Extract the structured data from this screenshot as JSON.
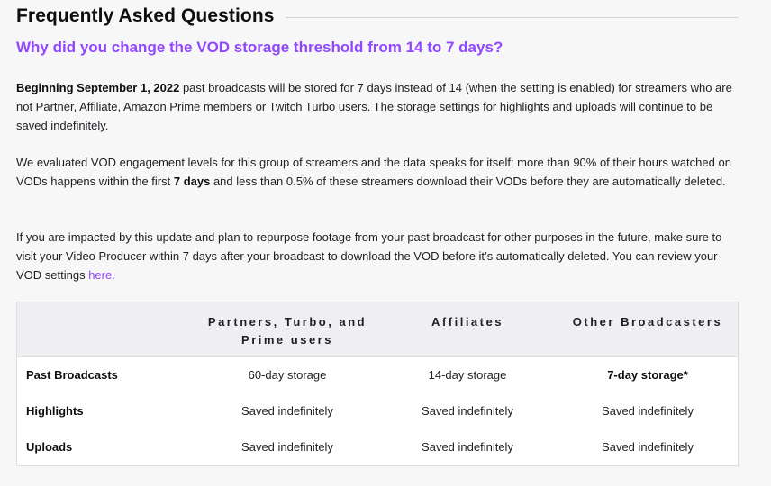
{
  "faq": {
    "title": "Frequently Asked Questions",
    "question": "Why did you change the VOD storage threshold from 14 to 7 days?",
    "p1": {
      "bold_lead": "Beginning September 1, 2022",
      "text": " past broadcasts will be stored for 7 days instead of 14 (when the setting is enabled) for streamers who are not Partner, Affiliate, Amazon Prime members or Twitch Turbo users. The storage settings for highlights and uploads will continue to be saved indefinitely."
    },
    "p2": {
      "text_before": "We evaluated VOD engagement levels for this group of streamers and the data speaks for itself: more than 90% of their hours watched on VODs happens within the first ",
      "bold": "7 days",
      "text_after": " and less than 0.5% of these streamers download their VODs before they are automatically deleted."
    },
    "p3": {
      "text": "If you are impacted by this update and plan to repurpose footage from your past broadcast for other purposes in the future, make sure to visit your Video Producer within 7 days after your broadcast to download the VOD before it’s automatically deleted. You can review your VOD settings ",
      "link": "here."
    }
  },
  "table": {
    "headers": [
      "Partners, Turbo, and Prime users",
      "Affiliates",
      "Other Broadcasters"
    ],
    "rows": [
      {
        "label": "Past Broadcasts",
        "cells": [
          "60-day storage",
          "14-day storage",
          "7-day storage*"
        ]
      },
      {
        "label": "Highlights",
        "cells": [
          "Saved indefinitely",
          "Saved indefinitely",
          "Saved indefinitely"
        ]
      },
      {
        "label": "Uploads",
        "cells": [
          "Saved indefinitely",
          "Saved indefinitely",
          "Saved indefinitely"
        ]
      }
    ]
  },
  "colors": {
    "accent": "#9147ff",
    "text": "#1f1f23",
    "table_header_bg": "#efeff1"
  }
}
